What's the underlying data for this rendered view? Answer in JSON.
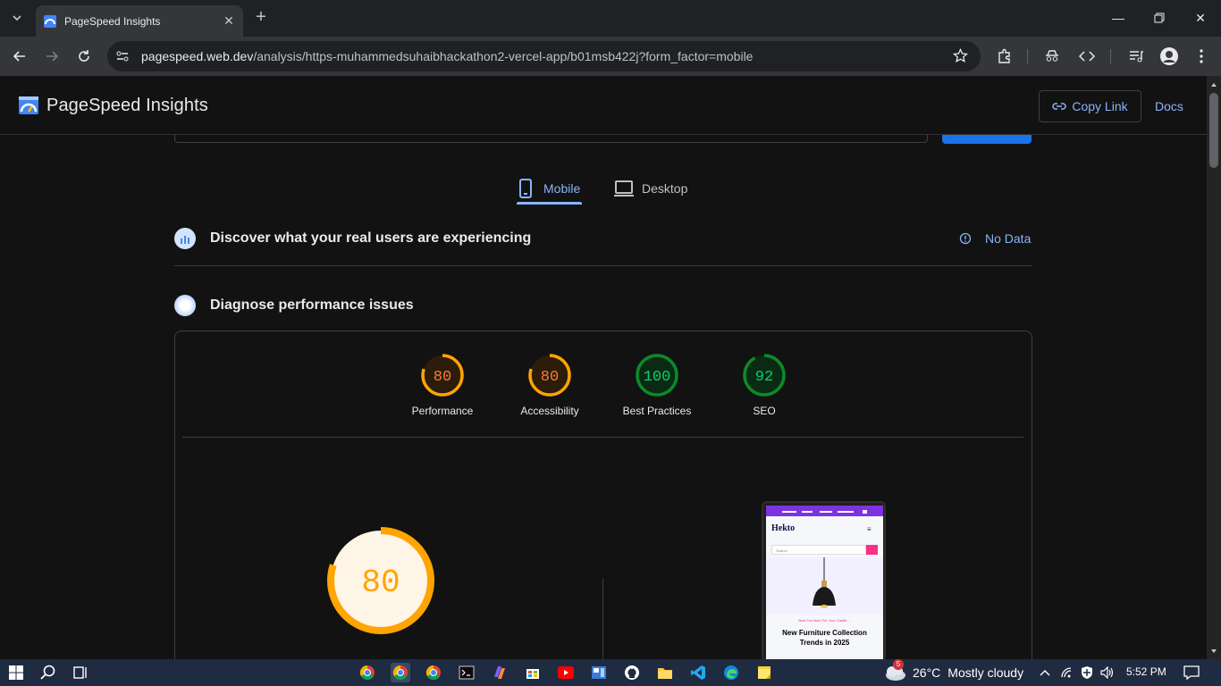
{
  "browser": {
    "tab_title": "PageSpeed Insights",
    "url_host": "pagespeed.web.dev",
    "url_path": "/analysis/https-muhammedsuhaibhackathon2-vercel-app/b01msb422j?form_factor=mobile"
  },
  "header": {
    "brand": "PageSpeed Insights",
    "copy_link": "Copy Link",
    "docs": "Docs"
  },
  "form_factor_tabs": {
    "mobile": "Mobile",
    "desktop": "Desktop"
  },
  "real_users": {
    "title": "Discover what your real users are experiencing",
    "status": "No Data"
  },
  "diagnose": {
    "title": "Diagnose performance issues"
  },
  "scores": [
    {
      "label": "Performance",
      "value": 80,
      "status": "average"
    },
    {
      "label": "Accessibility",
      "value": 80,
      "status": "average"
    },
    {
      "label": "Best Practices",
      "value": 100,
      "status": "pass"
    },
    {
      "label": "SEO",
      "value": 92,
      "status": "pass"
    }
  ],
  "main_score": {
    "value": 80
  },
  "colors": {
    "average": "#ffa400",
    "average_text": "#ff7a3a",
    "pass": "#0c8a2a",
    "pass_text": "#0cce6b",
    "link": "#8ab4f8",
    "primary": "#1a73e8"
  },
  "preview": {
    "brand": "Hekto",
    "search_placeholder": "Search",
    "tagline": "Best Furniture For Your Castle....",
    "headline": "New Furniture Collection Trends in 2025"
  },
  "taskbar": {
    "weather_temp": "26°C",
    "weather_desc": "Mostly cloudy",
    "weather_badge": "5",
    "time": "5:52 PM"
  }
}
